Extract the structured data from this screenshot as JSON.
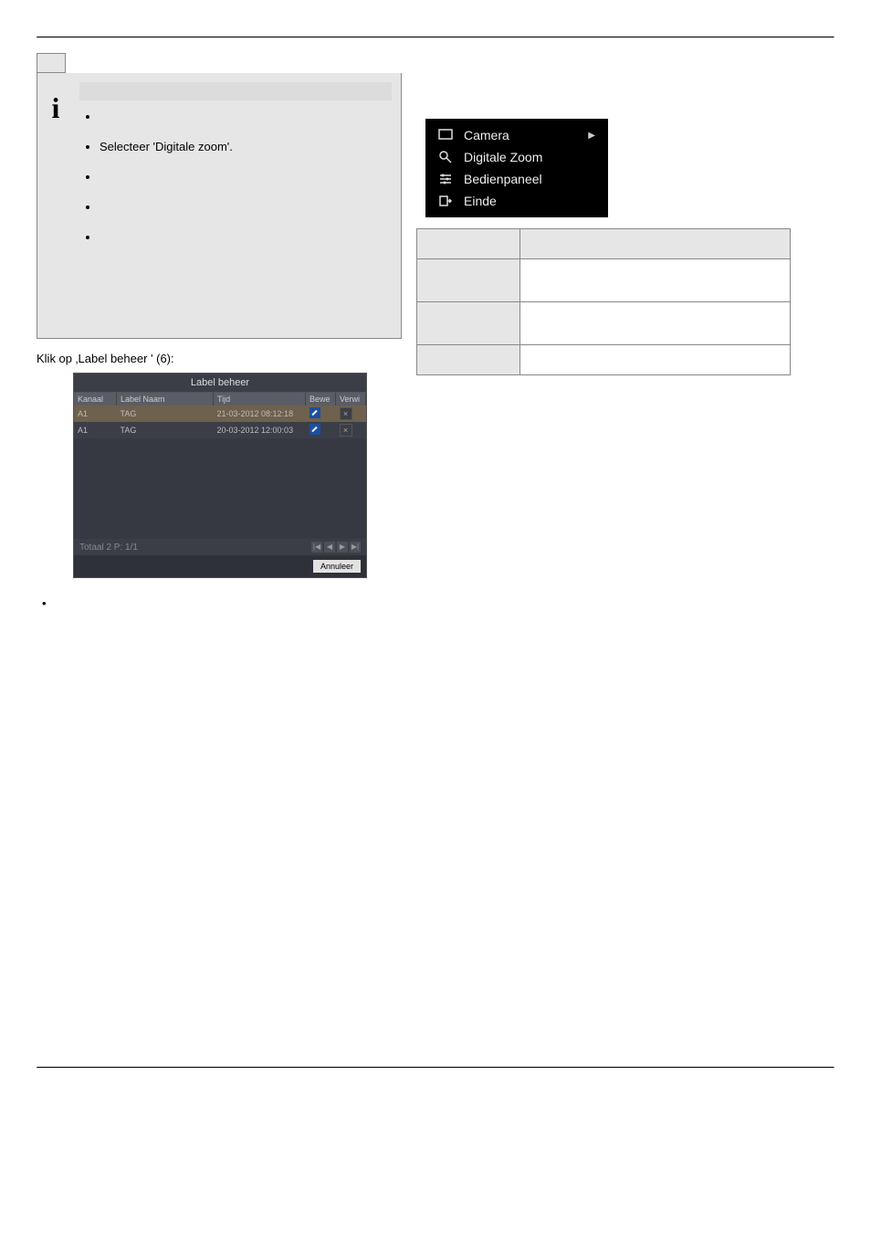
{
  "info": {
    "bullets": [
      "",
      "Selecteer 'Digitale zoom'.",
      "",
      "",
      ""
    ]
  },
  "subheading": "Klik op ‚Label beheer ' (6):",
  "label_dialog": {
    "title": "Label beheer",
    "columns": {
      "kanaal": "Kanaal",
      "label_naam": "Label Naam",
      "tijd": "Tijd",
      "bewe": "Bewe",
      "verwi": "Verwi"
    },
    "rows": [
      {
        "kanaal": "A1",
        "label_naam": "TAG",
        "tijd": "21-03-2012 08:12:18"
      },
      {
        "kanaal": "A1",
        "label_naam": "TAG",
        "tijd": "20-03-2012 12:00:03"
      }
    ],
    "footer_total": "Totaal 2 P: 1/1",
    "cancel": "Annuleer",
    "pager": [
      "|◀",
      "◀",
      "▶",
      "▶|"
    ]
  },
  "context_menu": {
    "items": [
      {
        "icon": "monitor",
        "label": "Camera",
        "has_submenu": true
      },
      {
        "icon": "zoom",
        "label": "Digitale Zoom",
        "has_submenu": false
      },
      {
        "icon": "panel",
        "label": "Bedienpaneel",
        "has_submenu": false
      },
      {
        "icon": "exit",
        "label": "Einde",
        "has_submenu": false
      }
    ]
  }
}
